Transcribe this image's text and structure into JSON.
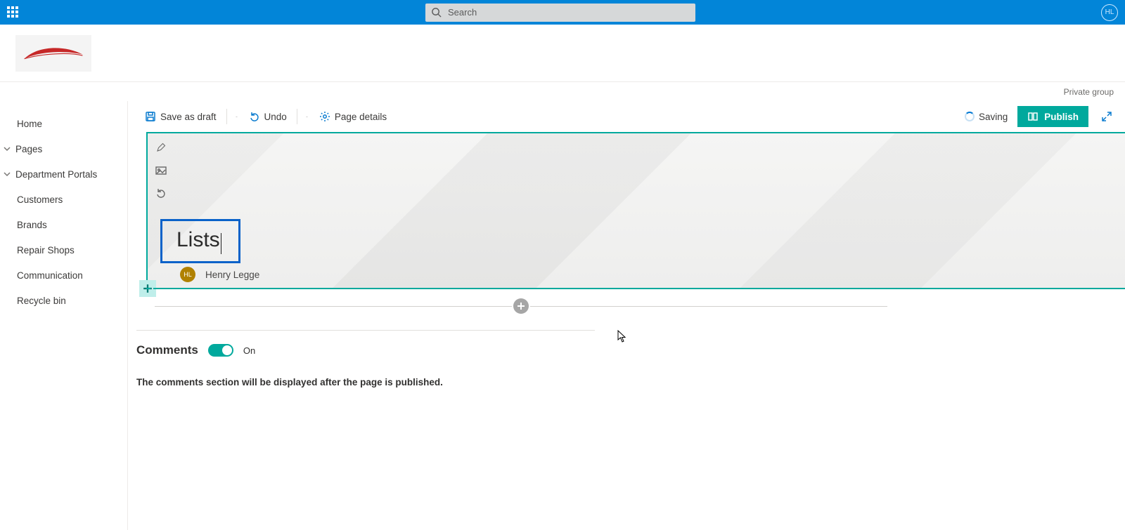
{
  "appbar": {
    "search_placeholder": "Search",
    "user_initials": "HL"
  },
  "substrip": {
    "label": "Private group"
  },
  "sidebar": {
    "home": "Home",
    "pages": "Pages",
    "dept": "Department Portals",
    "children": {
      "customers": "Customers",
      "brands": "Brands",
      "repair": "Repair Shops",
      "comm": "Communication"
    },
    "recycle": "Recycle bin"
  },
  "cmdbar": {
    "save_draft": "Save as draft",
    "undo": "Undo",
    "page_details": "Page details",
    "saving": "Saving",
    "publish": "Publish"
  },
  "hero": {
    "title": "Lists",
    "author_initials": "HL",
    "author_name": "Henry Legge"
  },
  "comments": {
    "heading": "Comments",
    "state": "On",
    "message": "The comments section will be displayed after the page is published."
  }
}
